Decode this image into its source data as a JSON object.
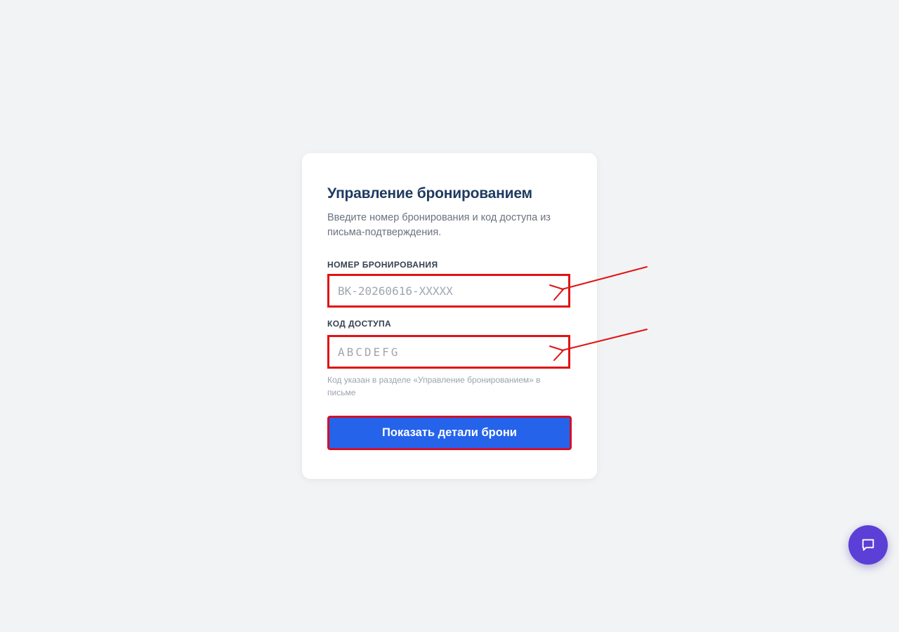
{
  "form": {
    "title": "Управление бронированием",
    "subtitle": "Введите номер бронирования и код доступа из письма-подтверждения.",
    "booking_number": {
      "label": "НОМЕР БРОНИРОВАНИЯ",
      "placeholder": "BK-20260616-XXXXX",
      "value": ""
    },
    "access_code": {
      "label": "КОД ДОСТУПА",
      "placeholder": "ABCDEFG",
      "value": "",
      "hint": "Код указан в разделе «Управление бронированием» в письме"
    },
    "submit_label": "Показать детали брони"
  },
  "chat_button": {
    "icon": "chat-bubble-icon",
    "color": "#5b3fd6"
  },
  "colors": {
    "background": "#f2f3f5",
    "primary": "#2563eb",
    "title": "#1e3a5f",
    "annotation": "#e11313"
  }
}
